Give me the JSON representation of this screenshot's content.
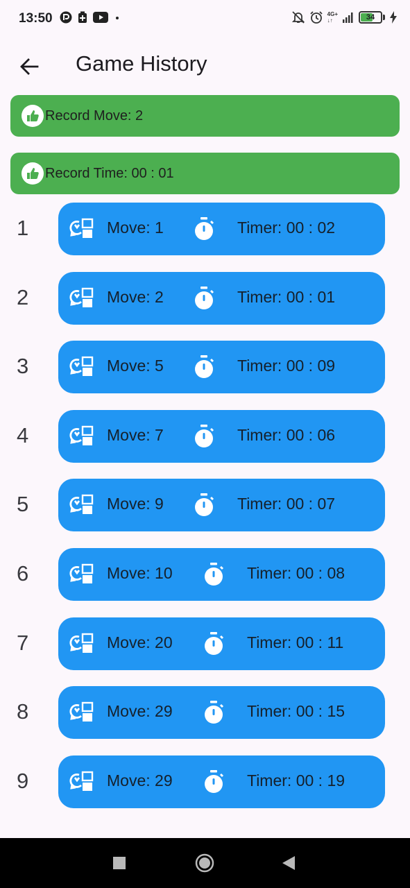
{
  "status_bar": {
    "time": "13:50",
    "network_top": "4G+",
    "network_bottom": "↓↑",
    "battery": "34"
  },
  "app_bar": {
    "title": "Game History"
  },
  "records": [
    {
      "label": "Record Move: 2"
    },
    {
      "label": "Record Time: 00 : 01"
    }
  ],
  "history": [
    {
      "index": "1",
      "move": "Move: 1",
      "timer": "Timer: 00 : 02"
    },
    {
      "index": "2",
      "move": "Move: 2",
      "timer": "Timer: 00 : 01"
    },
    {
      "index": "3",
      "move": "Move: 5",
      "timer": "Timer: 00 : 09"
    },
    {
      "index": "4",
      "move": "Move: 7",
      "timer": "Timer: 00 : 06"
    },
    {
      "index": "5",
      "move": "Move: 9",
      "timer": "Timer: 00 : 07"
    },
    {
      "index": "6",
      "move": "Move: 10",
      "timer": "Timer: 00 : 08"
    },
    {
      "index": "7",
      "move": "Move: 20",
      "timer": "Timer: 00 : 11"
    },
    {
      "index": "8",
      "move": "Move: 29",
      "timer": "Timer: 00 : 15"
    },
    {
      "index": "9",
      "move": "Move: 29",
      "timer": "Timer: 00 : 19"
    }
  ],
  "icons": {
    "record": "thumb-up-icon",
    "move": "swap-move-icon",
    "timer": "stopwatch-icon",
    "back": "arrow-back-icon"
  },
  "colors": {
    "record_card": "#4caf50",
    "history_card": "#2196f3",
    "background": "#fcf7fc"
  }
}
